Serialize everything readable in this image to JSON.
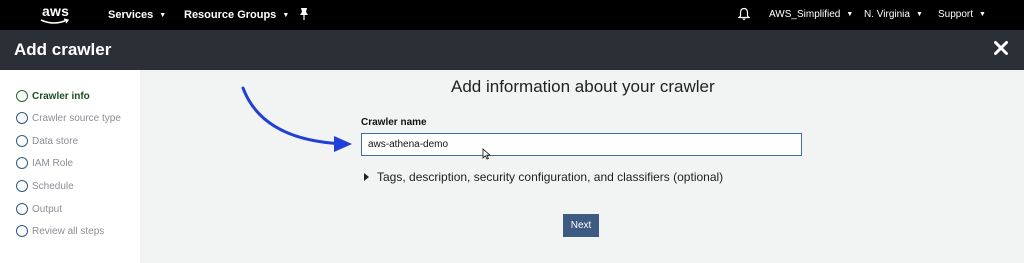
{
  "topnav": {
    "logo_text": "aws",
    "services_label": "Services",
    "resource_groups_label": "Resource Groups",
    "account_label": "AWS_Simplified",
    "region_label": "N. Virginia",
    "support_label": "Support"
  },
  "header": {
    "title": "Add crawler"
  },
  "steps": {
    "items": [
      {
        "label": "Crawler info"
      },
      {
        "label": "Crawler source type"
      },
      {
        "label": "Data store"
      },
      {
        "label": "IAM Role"
      },
      {
        "label": "Schedule"
      },
      {
        "label": "Output"
      },
      {
        "label": "Review all steps"
      }
    ]
  },
  "main": {
    "title": "Add information about your crawler",
    "crawler_name_label": "Crawler name",
    "crawler_name_value": "aws-athena-demo",
    "optional_section_label": "Tags, description, security configuration, and classifiers (optional)",
    "next_label": "Next"
  },
  "colors": {
    "nav_bg": "#000000",
    "header_bg": "#2b3036",
    "active_step": "#1f6b2a",
    "button_bg": "#3d5a80",
    "annotation_arrow": "#1f3fd6"
  }
}
